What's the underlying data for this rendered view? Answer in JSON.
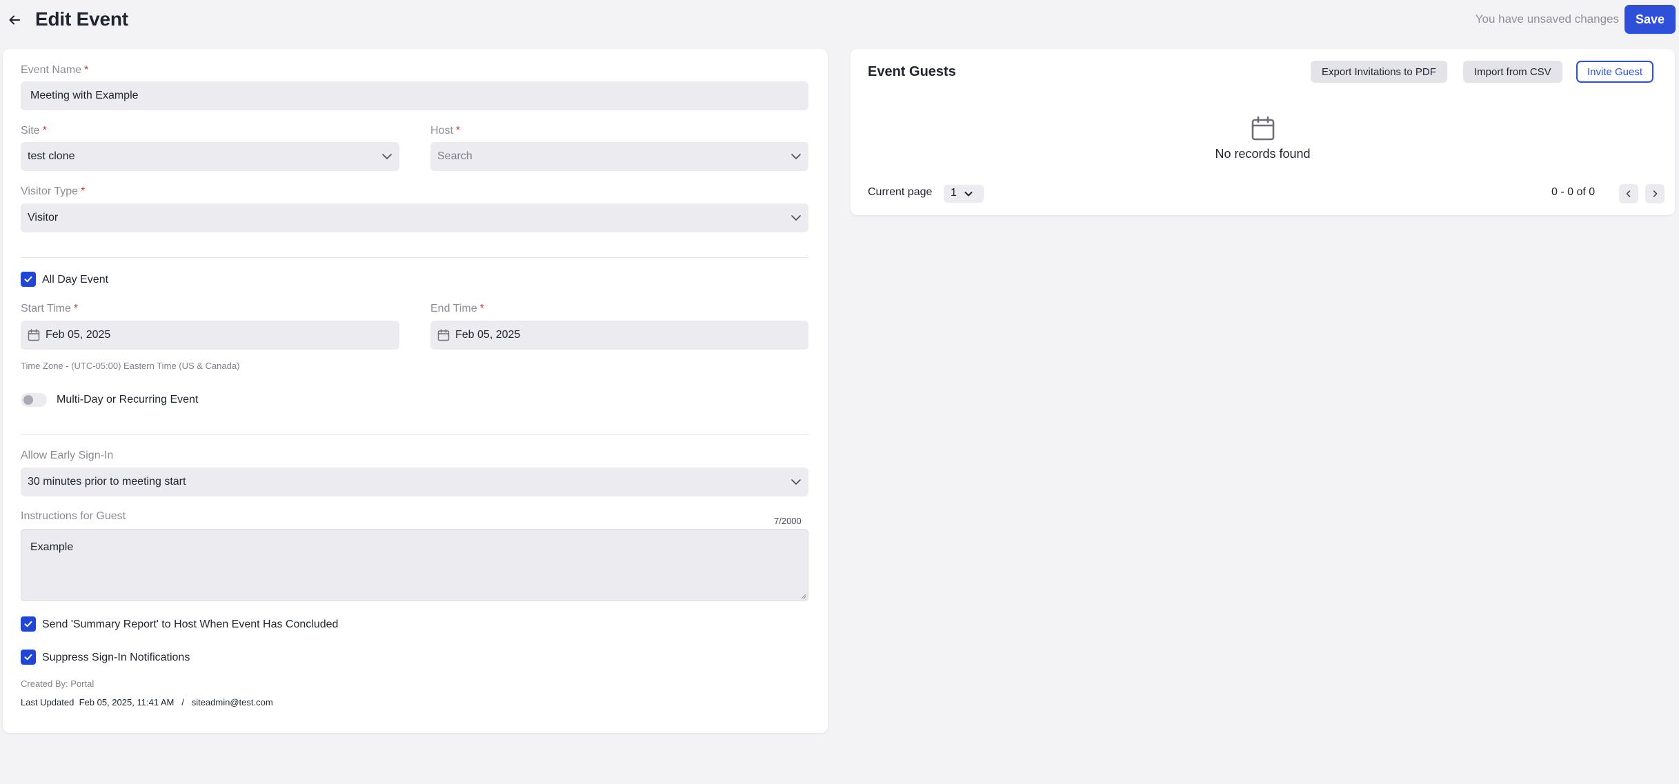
{
  "header": {
    "title": "Edit Event",
    "unsaved_text": "You have unsaved changes",
    "save_label": "Save"
  },
  "form": {
    "event_name": {
      "label": "Event Name",
      "required_mark": "*",
      "value": "Meeting with Example"
    },
    "site": {
      "label": "Site",
      "required_mark": "*",
      "value": "test clone"
    },
    "host": {
      "label": "Host",
      "required_mark": "*",
      "placeholder": "Search"
    },
    "visitor_type": {
      "label": "Visitor Type",
      "required_mark": "*",
      "value": "Visitor"
    },
    "all_day": {
      "label": "All Day Event",
      "checked": true
    },
    "start_time": {
      "label": "Start Time",
      "required_mark": "*",
      "value": "Feb 05, 2025"
    },
    "end_time": {
      "label": "End Time",
      "required_mark": "*",
      "value": "Feb 05, 2025"
    },
    "time_zone": "Time Zone - (UTC-05:00) Eastern Time (US & Canada)",
    "multi_day": {
      "label": "Multi-Day or Recurring Event",
      "on": false
    },
    "early_sign_in": {
      "label": "Allow Early Sign-In",
      "value": "30 minutes prior to meeting start"
    },
    "instructions": {
      "label": "Instructions for Guest",
      "counter": "7/2000",
      "value": "Example"
    },
    "summary_report": {
      "label": "Send 'Summary Report' to Host When Event Has Concluded",
      "checked": true
    },
    "suppress_notifications": {
      "label": "Suppress Sign-In Notifications",
      "checked": true
    },
    "created_by": "Created By: Portal",
    "last_updated_label": "Last Updated",
    "last_updated_value": "Feb 05, 2025, 11:41 AM",
    "separator": "/",
    "last_updated_by": "siteadmin@test.com"
  },
  "guests": {
    "title": "Event Guests",
    "export_label": "Export Invitations to PDF",
    "import_label": "Import from CSV",
    "invite_label": "Invite Guest",
    "empty_text": "No records found",
    "current_page_label": "Current page",
    "current_page_value": "1",
    "range_text": "0 - 0 of 0"
  },
  "colors": {
    "accent": "#2e4fd8",
    "checkbox": "#2146d6",
    "required": "#e02b2b",
    "field_bg": "#ebebf0",
    "page_bg": "#f3f3f6"
  },
  "icons": {
    "back": "arrow-left-icon",
    "chevron": "chevron-down-icon",
    "calendar": "calendar-icon",
    "check": "checkmark-icon",
    "prev": "chevron-left-icon",
    "next": "chevron-right-icon"
  }
}
